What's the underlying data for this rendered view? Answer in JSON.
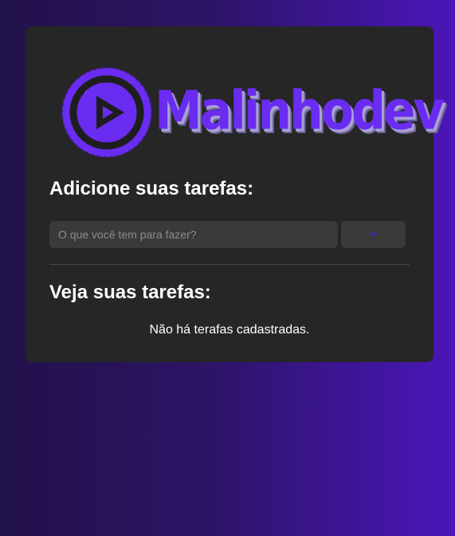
{
  "logo": {
    "text": "Malinhodev",
    "icon": "play-icon",
    "colors": {
      "brand": "#6a2cf0",
      "emblem_dark": "#1e1e1e"
    }
  },
  "add_section": {
    "title": "Adicione suas tarefas:",
    "input_placeholder": "O que você tem para fazer?",
    "input_value": "",
    "add_button_label": "+"
  },
  "list_section": {
    "title": "Veja suas tarefas:",
    "empty_message": "Não há terafas cadastradas."
  },
  "colors": {
    "card_bg": "#262626",
    "input_bg": "#3a3a3a",
    "accent": "#4f1fd0",
    "background_start": "#22124a",
    "background_end": "#4a16b8"
  }
}
